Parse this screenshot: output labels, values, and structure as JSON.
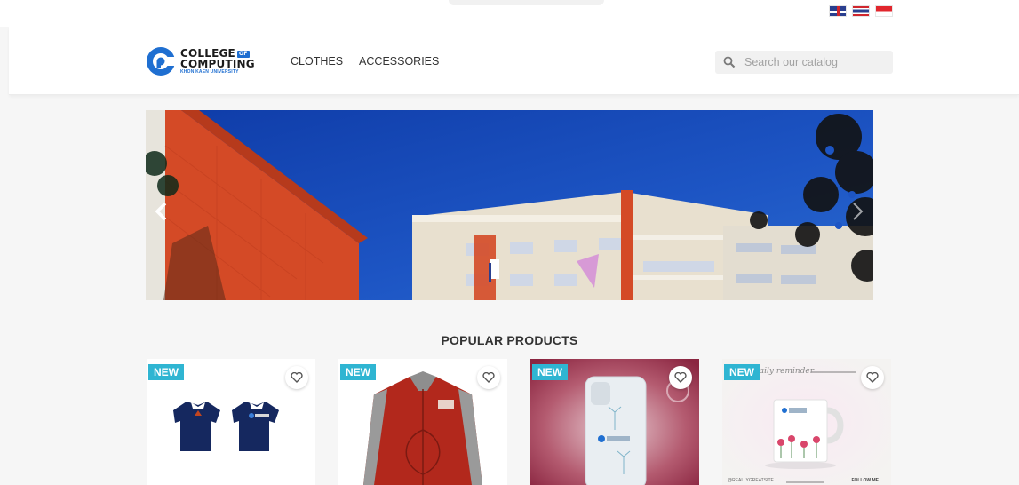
{
  "languages": [
    {
      "name": "English",
      "icon": "uk-flag-icon"
    },
    {
      "name": "Thai",
      "icon": "thailand-flag-icon"
    },
    {
      "name": "Indonesian",
      "icon": "indonesia-flag-icon"
    }
  ],
  "logo": {
    "line1": "COLLEGE",
    "tag": "OF",
    "line2": "COMPUTING",
    "line3": "KHON KAEN UNIVERSITY"
  },
  "nav": {
    "items": [
      {
        "label": "CLOTHES"
      },
      {
        "label": "ACCESSORIES"
      }
    ]
  },
  "search": {
    "placeholder": "Search our catalog",
    "icon": "search-icon"
  },
  "carousel": {
    "prev_icon": "chevron-left-icon",
    "next_icon": "chevron-right-icon",
    "image": "building-photo"
  },
  "section": {
    "title": "POPULAR PRODUCTS"
  },
  "products": [
    {
      "badge": "NEW",
      "image": "polo-shirts",
      "wishlist_icon": "heart-icon"
    },
    {
      "badge": "NEW",
      "image": "jacket",
      "wishlist_icon": "heart-icon"
    },
    {
      "badge": "NEW",
      "image": "phone-case",
      "wishlist_icon": "heart-icon"
    },
    {
      "badge": "NEW",
      "image": "mug",
      "wishlist_icon": "heart-icon",
      "image_text_top": "daily reminder",
      "image_text_bottom_left": "@REALLYGREATSITE",
      "image_text_bottom_right": "FOLLOW ME"
    }
  ],
  "colors": {
    "accent": "#2fb5d2",
    "brand_blue": "#1f6fd1",
    "building_orange": "#d44a26",
    "sky": "#1648b4",
    "jacket_red": "#b2281c",
    "phone_bg": "#9c2f49"
  }
}
